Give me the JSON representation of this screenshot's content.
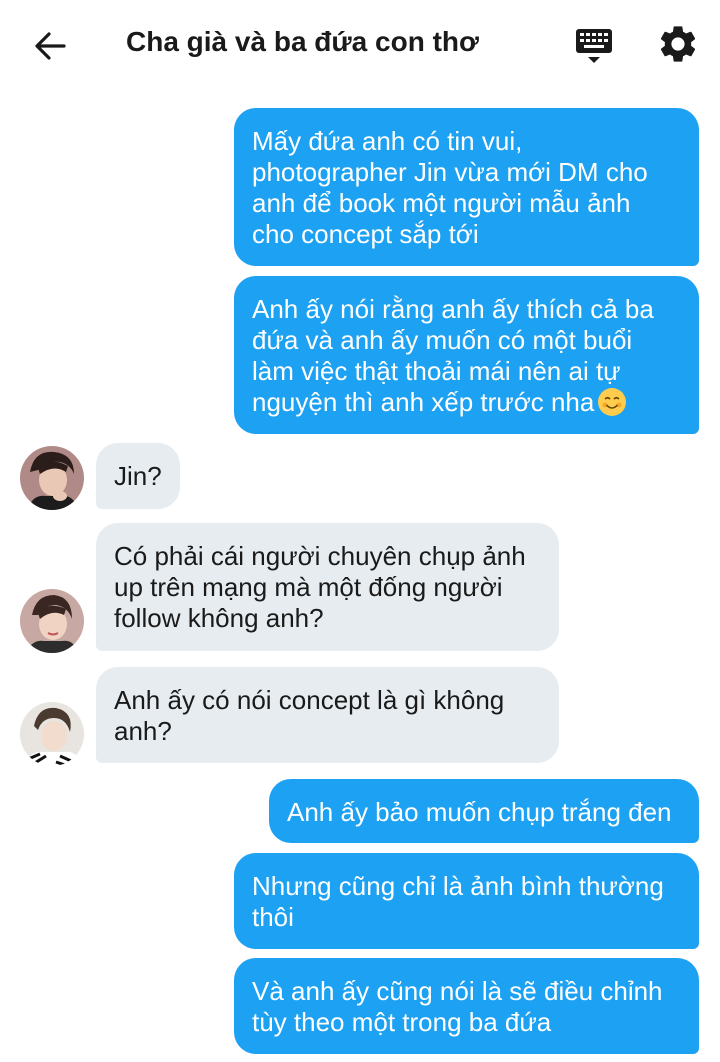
{
  "header": {
    "title": "Cha già và ba đứa con thơ",
    "back_icon": "arrow-left-icon",
    "keyboard_icon": "keyboard-icon",
    "settings_icon": "gear-icon"
  },
  "colors": {
    "outgoing_bubble": "#1da1f2",
    "incoming_bubble": "#e6ecf0"
  },
  "messages": [
    {
      "side": "out",
      "lines": [
        "Mấy đứa anh có tin vui,",
        "photographer Jin vừa mới DM cho",
        "anh để book một người mẫu ảnh",
        "cho concept sắp tới"
      ]
    },
    {
      "side": "out",
      "lines": [
        "Anh ấy nói rằng anh ấy thích cả ba",
        "đứa và anh ấy muốn có một buổi",
        "làm việc thật thoải mái nên ai tự",
        "nguyện thì anh xếp trước nha"
      ],
      "emoji": "smiling-face-icon"
    },
    {
      "side": "in",
      "lines": [
        "Jin?"
      ]
    },
    {
      "side": "in",
      "lines": [
        "Có phải cái người chuyên chụp ảnh",
        "up trên mạng mà một đống người",
        "follow không anh?"
      ]
    },
    {
      "side": "in",
      "lines": [
        "Anh ấy có nói concept là gì không",
        "anh?"
      ]
    },
    {
      "side": "out",
      "lines": [
        "Anh ấy bảo muốn chụp trắng đen"
      ]
    },
    {
      "side": "out",
      "lines": [
        "Nhưng cũng chỉ là ảnh bình thường",
        "thôi"
      ]
    },
    {
      "side": "out",
      "lines": [
        "Và anh ấy cũng nói là sẽ điều chỉnh",
        "tùy theo một trong ba đứa"
      ]
    }
  ]
}
